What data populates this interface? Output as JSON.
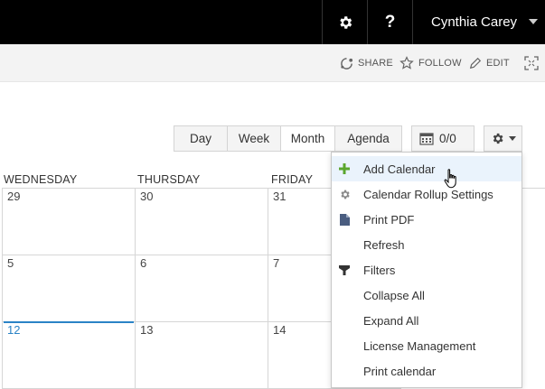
{
  "suite_bar": {
    "help_label": "?",
    "user_name": "Cynthia Carey"
  },
  "action_bar": {
    "share_label": "SHARE",
    "follow_label": "FOLLOW",
    "edit_label": "EDIT"
  },
  "view_toolbar": {
    "tabs": [
      {
        "label": "Day",
        "active": false
      },
      {
        "label": "Week",
        "active": false
      },
      {
        "label": "Month",
        "active": true
      },
      {
        "label": "Agenda",
        "active": false
      }
    ],
    "date_counter": "0/0"
  },
  "calendar": {
    "day_headers": [
      "WEDNESDAY",
      "THURSDAY",
      "FRIDAY"
    ],
    "rows": [
      [
        "29",
        "30",
        "31"
      ],
      [
        "5",
        "6",
        "7"
      ],
      [
        "12",
        "13",
        "14"
      ]
    ],
    "today": "12",
    "today_color": "#2a83c6"
  },
  "settings_menu": {
    "items": [
      {
        "label": "Add Calendar",
        "icon": "plus-icon"
      },
      {
        "label": "Calendar Rollup Settings",
        "icon": "gear-icon"
      },
      {
        "label": "Print PDF",
        "icon": "document-icon"
      },
      {
        "label": "Refresh",
        "icon": ""
      },
      {
        "label": "Filters",
        "icon": "filter-icon"
      },
      {
        "label": "Collapse All",
        "icon": ""
      },
      {
        "label": "Expand All",
        "icon": ""
      },
      {
        "label": "License Management",
        "icon": ""
      },
      {
        "label": "Print calendar",
        "icon": ""
      }
    ],
    "hover_color": "#eaf3fc",
    "plus_color": "#5aa62d"
  }
}
